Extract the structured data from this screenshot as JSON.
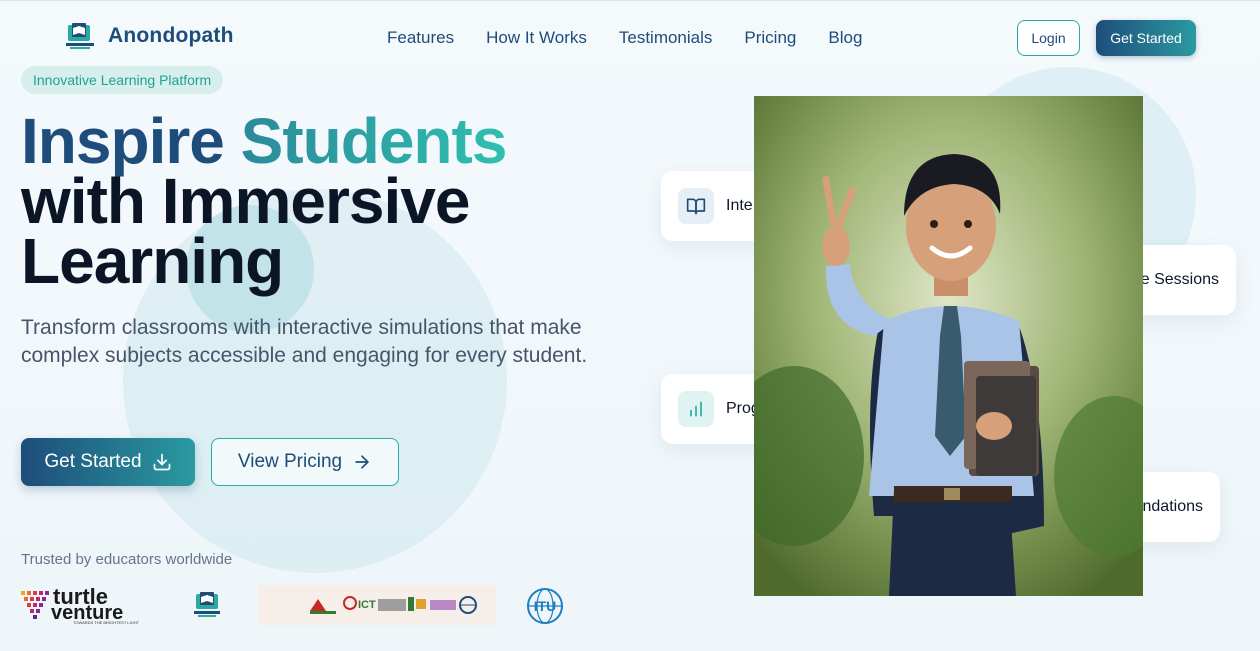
{
  "brand": {
    "name": "Anondopath"
  },
  "nav": {
    "links": [
      "Features",
      "How It Works",
      "Testimonials",
      "Pricing",
      "Blog"
    ],
    "login_label": "Login",
    "get_started_label": "Get Started"
  },
  "hero": {
    "badge": "Innovative Learning Platform",
    "headline_word1": "Inspire",
    "headline_word2": "Students",
    "headline_line2": "with Immersive",
    "headline_line3": "Learning",
    "lead": "Transform classrooms with interactive simulations that make complex subjects accessible and engaging for every student.",
    "primary_cta": "Get Started",
    "secondary_cta": "View Pricing",
    "trusted_text": "Trusted by educators worldwide"
  },
  "feature_cards": {
    "card1": "Inte",
    "card2": "Prog",
    "card3": "e Sessions",
    "card4": "ndations"
  },
  "partners": {
    "turtle_line1": "turtle",
    "turtle_line2": "venture",
    "turtle_tagline": "TOWARDS THE BRIGHTEST LIGHT",
    "ict_text": "ICT",
    "itu_text": "ITU"
  },
  "colors": {
    "brand_navy": "#1e4d7b",
    "brand_teal": "#2ba9a3",
    "badge_bg": "#d7efec"
  },
  "icons": {
    "card1": "book-open-icon",
    "card2": "bar-chart-icon",
    "primary_cta": "download-icon",
    "secondary_cta": "arrow-right-icon"
  }
}
